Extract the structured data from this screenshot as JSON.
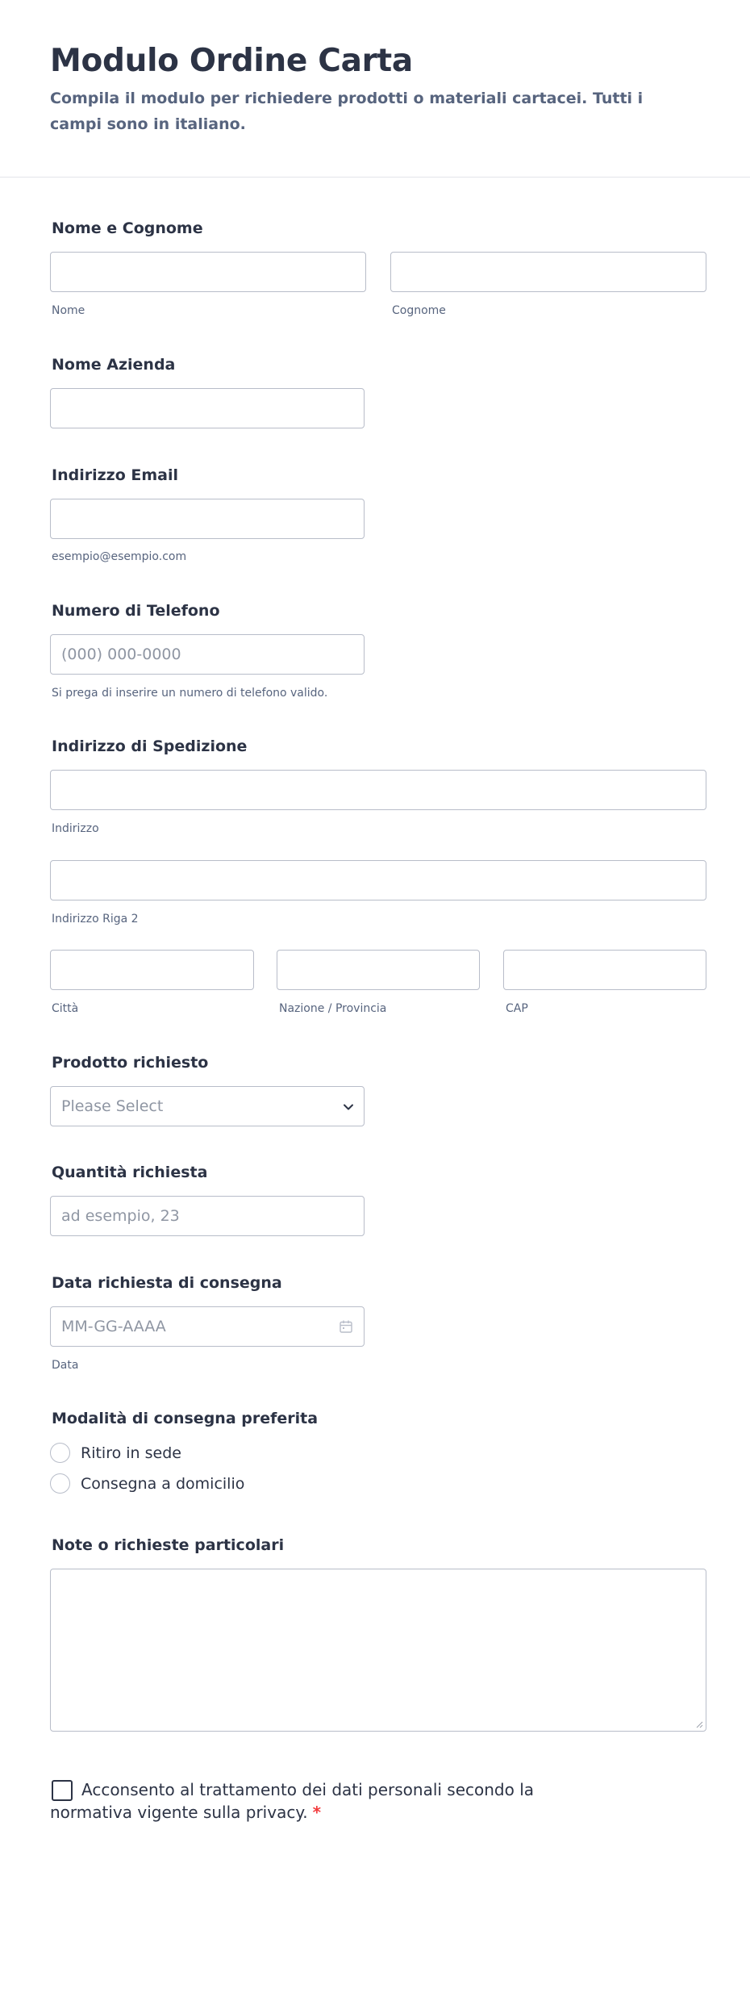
{
  "form": {
    "title": "Modulo Ordine Carta",
    "subtitle": "Compila il modulo per richiedere prodotti o materiali cartacei. Tutti i campi sono in italiano."
  },
  "fields": {
    "full_name": {
      "label": "Nome e Cognome",
      "first_sub": "Nome",
      "last_sub": "Cognome"
    },
    "company": {
      "label": "Nome Azienda"
    },
    "email": {
      "label": "Indirizzo Email",
      "sub": "esempio@esempio.com"
    },
    "phone": {
      "label": "Numero di Telefono",
      "placeholder": "(000) 000-0000",
      "sub": "Si prega di inserire un numero di telefono valido."
    },
    "address": {
      "label": "Indirizzo di Spedizione",
      "line1_sub": "Indirizzo",
      "line2_sub": "Indirizzo Riga 2",
      "city_sub": "Città",
      "state_sub": "Nazione / Provincia",
      "zip_sub": "CAP"
    },
    "product": {
      "label": "Prodotto richiesto",
      "placeholder": "Please Select"
    },
    "quantity": {
      "label": "Quantità richiesta",
      "placeholder": "ad esempio, 23"
    },
    "delivery_date": {
      "label": "Data richiesta di consegna",
      "placeholder": "MM-GG-AAAA",
      "sub": "Data"
    },
    "delivery_mode": {
      "label": "Modalità di consegna preferita",
      "options": [
        "Ritiro in sede",
        "Consegna a domicilio"
      ]
    },
    "notes": {
      "label": "Note o richieste particolari"
    },
    "consent": {
      "text": "Acconsento al trattamento dei dati personali secondo la normativa vigente sulla privacy.",
      "required_mark": "*"
    }
  },
  "colors": {
    "text": "#2c3345",
    "muted": "#57647e",
    "border": "#b8bdc9",
    "required": "#f23a3c"
  }
}
